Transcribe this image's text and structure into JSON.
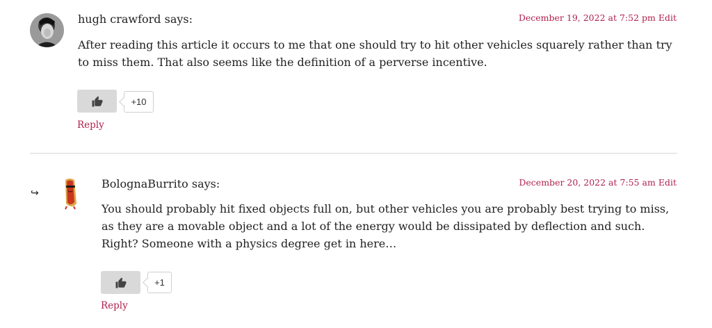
{
  "comments": [
    {
      "author": "hugh crawford",
      "says": "says:",
      "date": "December 19, 2022 at 7:52 pm",
      "edit_label": "Edit",
      "body": "After reading this article it occurs to me that one should try to hit other vehicles squarely rather than try to miss them. That also seems like the definition of a perverse incentive.",
      "like_count": "+10",
      "reply_label": "Reply",
      "avatar_icon": "user-photo-icon"
    },
    {
      "author": "BolognaBurrito",
      "says": "says:",
      "date": "December 20, 2022 at 7:55 am",
      "edit_label": "Edit",
      "body": "You should probably hit fixed objects full on, but other vehicles you are probably best trying to miss, as they are a movable object and a lot of the energy would be dissipated by deflection and such. Right? Someone with a physics degree get in here…",
      "like_count": "+1",
      "reply_label": "Reply",
      "avatar_icon": "hotdog-avatar-icon",
      "reply_indicator": "↪"
    }
  ],
  "colors": {
    "accent": "#b0214d",
    "like_button_bg": "#d9d9d9",
    "divider": "#d6d6d6"
  }
}
